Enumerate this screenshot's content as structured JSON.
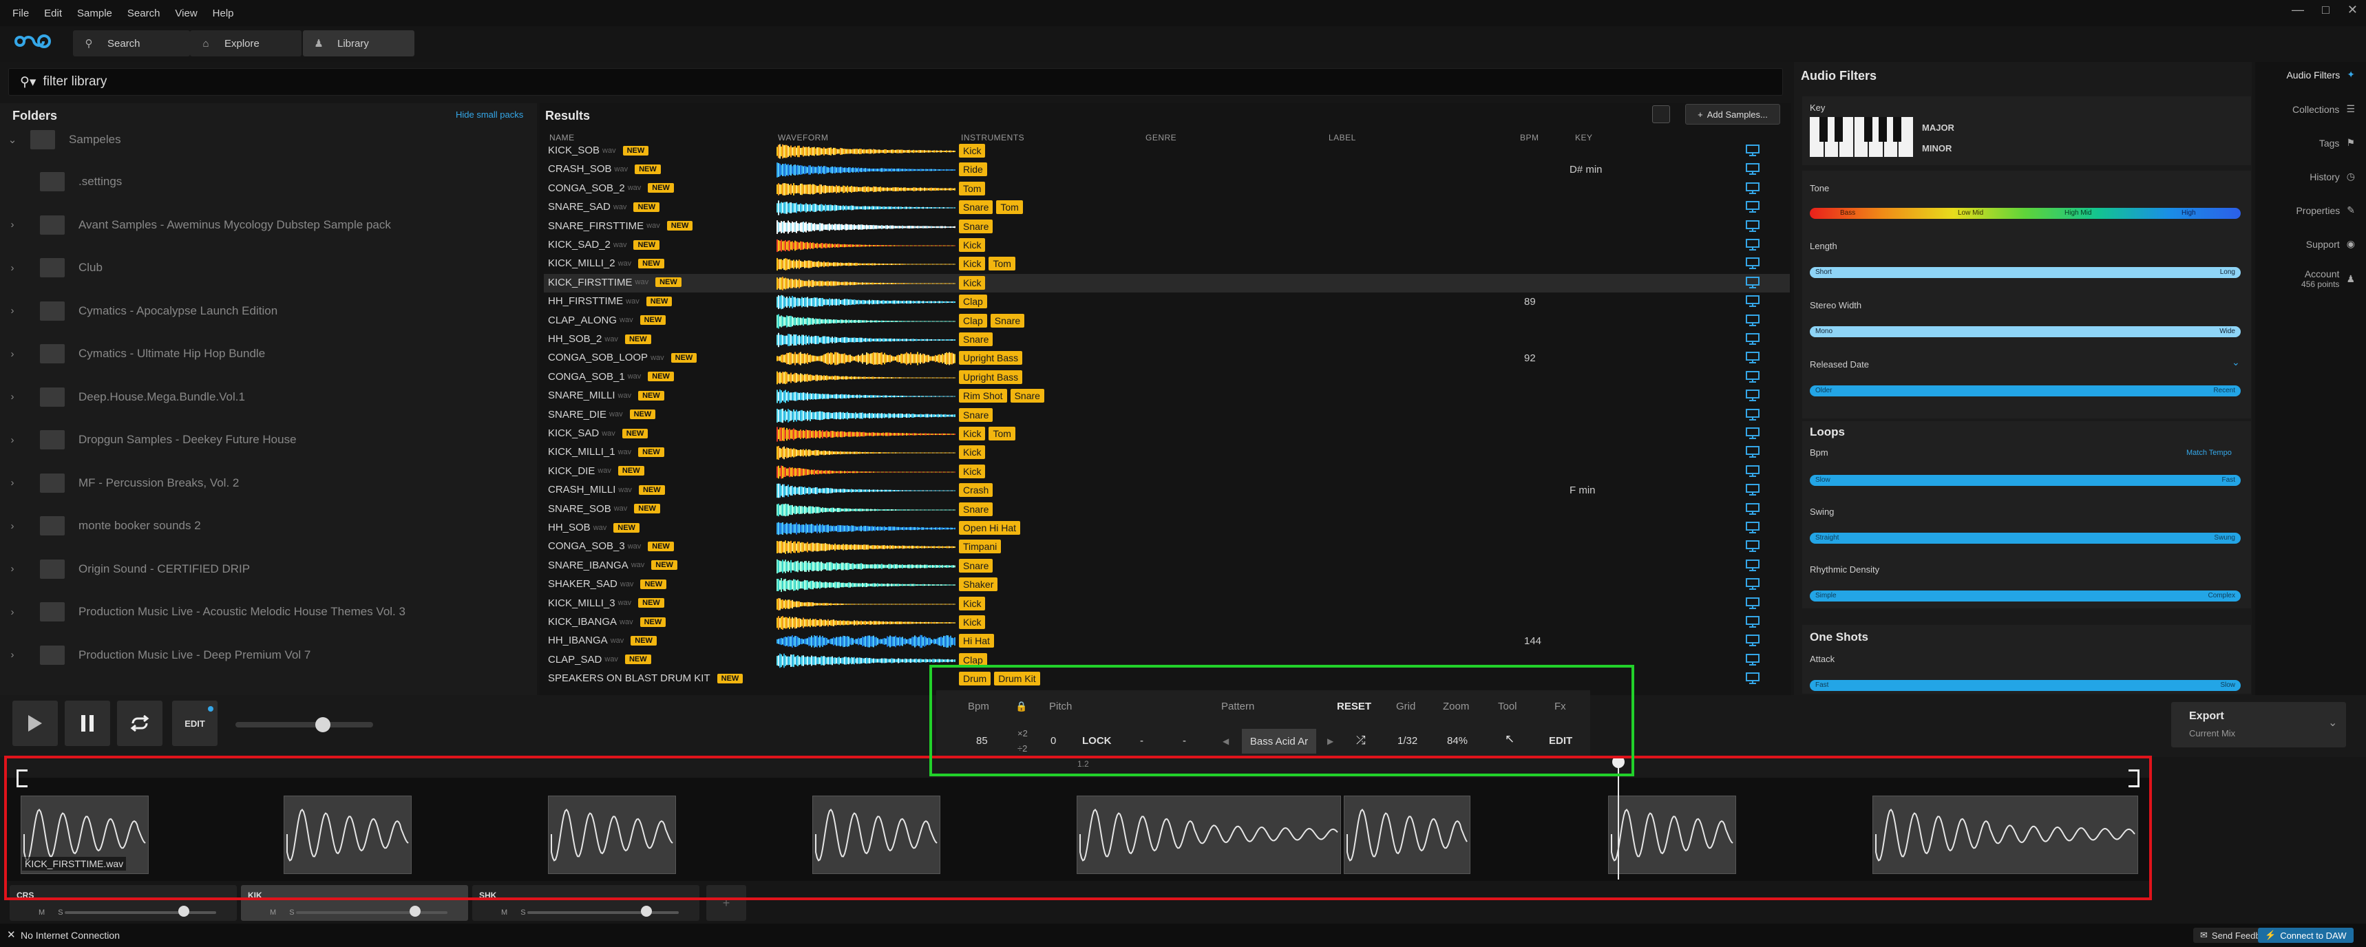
{
  "menu": [
    "File",
    "Edit",
    "Sample",
    "Search",
    "View",
    "Help"
  ],
  "nav": {
    "search": "Search",
    "explore": "Explore",
    "library": "Library"
  },
  "filter": {
    "text": "filter library"
  },
  "folders": {
    "title": "Folders",
    "hide": "Hide small packs",
    "root": "Sampeles",
    "items": [
      ".settings",
      "Avant Samples - Aweminus Mycology Dubstep Sample pack",
      "Club",
      "Cymatics - Apocalypse Launch Edition",
      "Cymatics - Ultimate Hip Hop Bundle",
      "Deep.House.Mega.Bundle.Vol.1",
      "Dropgun Samples - Deekey Future House",
      "MF - Percussion Breaks, Vol. 2",
      "monte booker sounds 2",
      "Origin Sound - CERTIFIED DRIP",
      "Production Music Live - Acoustic Melodic House Themes Vol. 3",
      "Production Music Live - Deep Premium Vol 7"
    ]
  },
  "results": {
    "title": "Results",
    "add": "Add Samples...",
    "columns": {
      "name": "NAME",
      "waveform": "WAVEFORM",
      "instruments": "INSTRUMENTS",
      "genre": "GENRE",
      "label": "LABEL",
      "bpm": "BPM",
      "key": "KEY"
    },
    "ext": "wav",
    "new": "NEW",
    "rows": [
      {
        "name": "KICK_SOB",
        "tags": [
          "Kick"
        ],
        "bpm": "",
        "key": "",
        "color": "yellow"
      },
      {
        "name": "CRASH_SOB",
        "tags": [
          "Ride"
        ],
        "bpm": "",
        "key": "D# min",
        "color": "blue"
      },
      {
        "name": "CONGA_SOB_2",
        "tags": [
          "Tom"
        ],
        "bpm": "",
        "key": "",
        "color": "yellow"
      },
      {
        "name": "SNARE_SAD",
        "tags": [
          "Snare",
          "Tom"
        ],
        "bpm": "",
        "key": "",
        "color": "cyan"
      },
      {
        "name": "SNARE_FIRSTTIME",
        "tags": [
          "Snare"
        ],
        "bpm": "",
        "key": "",
        "color": "white"
      },
      {
        "name": "KICK_SAD_2",
        "tags": [
          "Kick"
        ],
        "bpm": "",
        "key": "",
        "color": "red"
      },
      {
        "name": "KICK_MILLI_2",
        "tags": [
          "Kick",
          "Tom"
        ],
        "bpm": "",
        "key": "",
        "color": "yellow"
      },
      {
        "name": "KICK_FIRSTTIME",
        "tags": [
          "Kick"
        ],
        "bpm": "",
        "key": "",
        "color": "yellow"
      },
      {
        "name": "HH_FIRSTTIME",
        "tags": [
          "Clap"
        ],
        "bpm": "89",
        "key": "",
        "color": "cyan"
      },
      {
        "name": "CLAP_ALONG",
        "tags": [
          "Clap",
          "Snare"
        ],
        "bpm": "",
        "key": "",
        "color": "teal"
      },
      {
        "name": "HH_SOB_2",
        "tags": [
          "Snare"
        ],
        "bpm": "",
        "key": "",
        "color": "cyan"
      },
      {
        "name": "CONGA_SOB_LOOP",
        "tags": [
          "Upright Bass"
        ],
        "bpm": "92",
        "key": "",
        "color": "yellow"
      },
      {
        "name": "CONGA_SOB_1",
        "tags": [
          "Upright Bass"
        ],
        "bpm": "",
        "key": "",
        "color": "yellow"
      },
      {
        "name": "SNARE_MILLI",
        "tags": [
          "Rim Shot",
          "Snare"
        ],
        "bpm": "",
        "key": "",
        "color": "cyan"
      },
      {
        "name": "SNARE_DIE",
        "tags": [
          "Snare"
        ],
        "bpm": "",
        "key": "",
        "color": "cyan"
      },
      {
        "name": "KICK_SAD",
        "tags": [
          "Kick",
          "Tom"
        ],
        "bpm": "",
        "key": "",
        "color": "red"
      },
      {
        "name": "KICK_MILLI_1",
        "tags": [
          "Kick"
        ],
        "bpm": "",
        "key": "",
        "color": "yellow"
      },
      {
        "name": "KICK_DIE",
        "tags": [
          "Kick"
        ],
        "bpm": "",
        "key": "",
        "color": "red"
      },
      {
        "name": "CRASH_MILLI",
        "tags": [
          "Crash"
        ],
        "bpm": "",
        "key": "F min",
        "color": "cyan"
      },
      {
        "name": "SNARE_SOB",
        "tags": [
          "Snare"
        ],
        "bpm": "",
        "key": "",
        "color": "teal"
      },
      {
        "name": "HH_SOB",
        "tags": [
          "Open Hi Hat"
        ],
        "bpm": "",
        "key": "",
        "color": "blue"
      },
      {
        "name": "CONGA_SOB_3",
        "tags": [
          "Timpani"
        ],
        "bpm": "",
        "key": "",
        "color": "yellow"
      },
      {
        "name": "SNARE_IBANGA",
        "tags": [
          "Snare"
        ],
        "bpm": "",
        "key": "",
        "color": "teal"
      },
      {
        "name": "SHAKER_SAD",
        "tags": [
          "Shaker"
        ],
        "bpm": "",
        "key": "",
        "color": "teal"
      },
      {
        "name": "KICK_MILLI_3",
        "tags": [
          "Kick"
        ],
        "bpm": "",
        "key": "",
        "color": "yellow"
      },
      {
        "name": "KICK_IBANGA",
        "tags": [
          "Kick"
        ],
        "bpm": "",
        "key": "",
        "color": "yellow"
      },
      {
        "name": "HH_IBANGA",
        "tags": [
          "Hi Hat"
        ],
        "bpm": "144",
        "key": "",
        "color": "blue"
      },
      {
        "name": "CLAP_SAD",
        "tags": [
          "Clap"
        ],
        "bpm": "",
        "key": "",
        "color": "cyan"
      },
      {
        "name": "SPEAKERS ON BLAST DRUM KIT",
        "tags": [
          "Drum",
          "Drum Kit"
        ],
        "bpm": "",
        "key": "",
        "color": "none"
      }
    ]
  },
  "filters": {
    "title": "Audio Filters",
    "key": "Key",
    "major": "MAJOR",
    "minor": "MINOR",
    "tone": "Tone",
    "tone_labels": [
      "Bass",
      "Low Mid",
      "High Mid",
      "High"
    ],
    "length": {
      "label": "Length",
      "min": "Short",
      "max": "Long"
    },
    "stereo": {
      "label": "Stereo Width",
      "min": "Mono",
      "max": "Wide"
    },
    "released": {
      "label": "Released Date",
      "min": "Older",
      "max": "Recent"
    },
    "loops": "Loops",
    "bpm": {
      "label": "Bpm",
      "match": "Match Tempo",
      "min": "Slow",
      "max": "Fast"
    },
    "swing": {
      "label": "Swing",
      "min": "Straight",
      "max": "Swung"
    },
    "density": {
      "label": "Rhythmic Density",
      "min": "Simple",
      "max": "Complex"
    },
    "oneshots": "One Shots",
    "attack": {
      "label": "Attack",
      "min": "Fast",
      "max": "Slow"
    }
  },
  "rail": {
    "audio_filters": "Audio Filters",
    "collections": "Collections",
    "tags": "Tags",
    "history": "History",
    "properties": "Properties",
    "support": "Support",
    "account": "Account",
    "points": "456 points"
  },
  "transport": {
    "edit": "EDIT",
    "volume": 0.7
  },
  "pattern_panel": {
    "bpm_label": "Bpm",
    "pitch_label": "Pitch",
    "pattern_label": "Pattern",
    "reset": "RESET",
    "grid_label": "Grid",
    "zoom_label": "Zoom",
    "tool_label": "Tool",
    "fx_label": "Fx",
    "bpm": "85",
    "x2": "×2",
    "d2": "÷2",
    "pitch": "0",
    "lock": "LOCK",
    "dash1": "-",
    "dash2": "-",
    "pattern": "Bass Acid Ar",
    "grid": "1/32",
    "zoom": "84%",
    "edit": "EDIT",
    "bar": "1.2"
  },
  "export": {
    "title": "Export",
    "sub": "Current Mix"
  },
  "sequencer": {
    "clip_name": "KICK_FIRSTTIME.wav"
  },
  "tracks": [
    {
      "name": "CRS",
      "vol": 0.75
    },
    {
      "name": "KIK",
      "vol": 0.75
    },
    {
      "name": "SHK",
      "vol": 0.75
    }
  ],
  "status": {
    "left": "No Internet Connection",
    "feedback": "Send Feedback",
    "connect": "Connect to DAW"
  },
  "colors": {
    "accent": "#f3b60f",
    "blue": "#23a5e6",
    "red_box": "#e0131b",
    "green_box": "#22d12a"
  }
}
